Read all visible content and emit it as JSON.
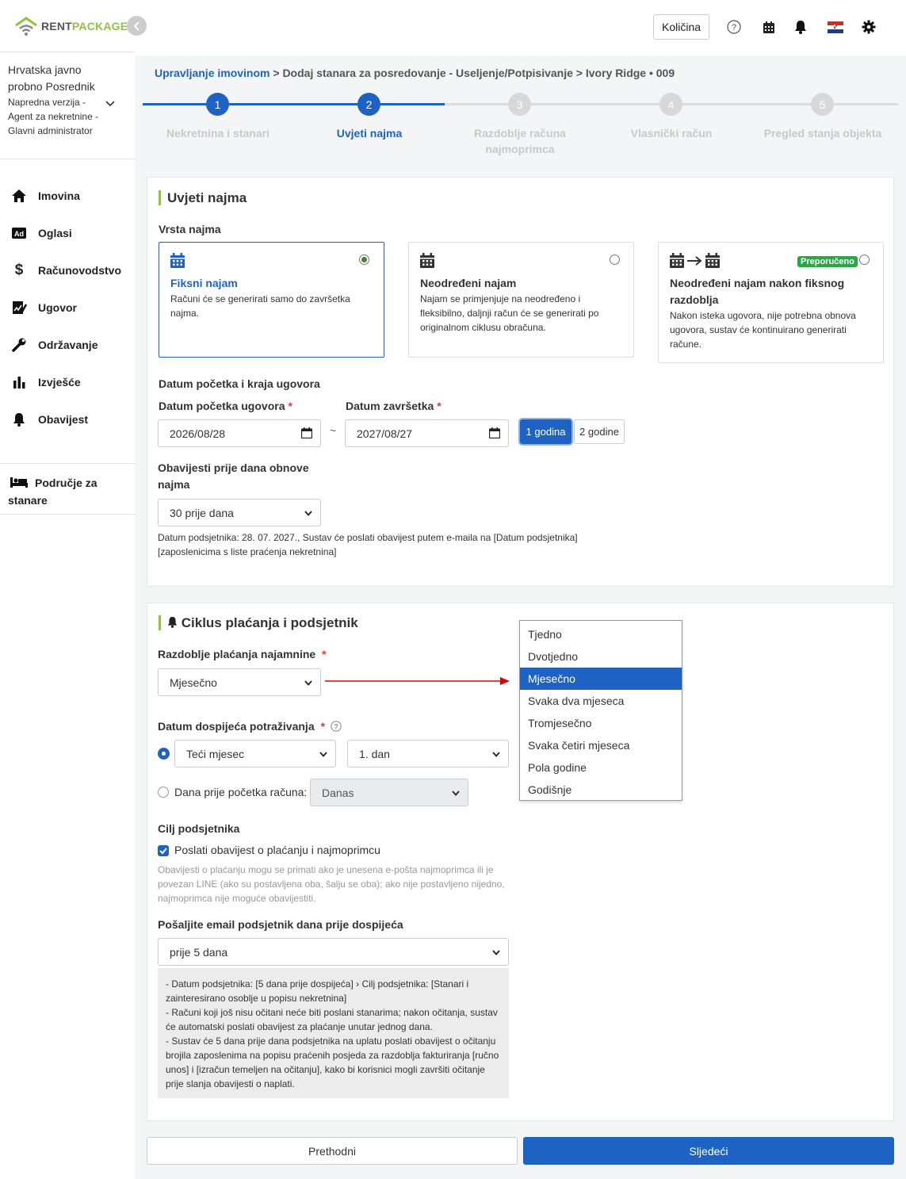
{
  "app": {
    "logo_text_1": "RENT",
    "logo_text_2": "PACKAGE"
  },
  "account": {
    "name": "Hrvatska javno probno Posrednik",
    "details": "Napredna verzija - Agent za nekretnine - Glavni administrator"
  },
  "sidebar": {
    "items": [
      {
        "label": "Imovina",
        "icon": "home-icon"
      },
      {
        "label": "Oglasi",
        "icon": "ad-icon"
      },
      {
        "label": "Računovodstvo",
        "icon": "dollar-icon"
      },
      {
        "label": "Ugovor",
        "icon": "contract-icon"
      },
      {
        "label": "Održavanje",
        "icon": "wrench-icon"
      },
      {
        "label": "Izvješće",
        "icon": "bar-chart-icon"
      },
      {
        "label": "Obavijest",
        "icon": "bell-icon"
      }
    ],
    "tenant_area": "Područje za stanare"
  },
  "topbar": {
    "quantity_button": "Količina"
  },
  "breadcrumb": {
    "root": "Upravljanje imovinom",
    "path": "> Dodaj stanara za posredovanje - Useljenje/Potpisivanje > Ivory Ridge • 009"
  },
  "stepper": {
    "active_step": 2,
    "steps": [
      {
        "num": "1",
        "label": "Nekretnina i stanari"
      },
      {
        "num": "2",
        "label": "Uvjeti najma"
      },
      {
        "num": "3",
        "label": "Razdoblje računa najmoprimca"
      },
      {
        "num": "4",
        "label": "Vlasnički račun"
      },
      {
        "num": "5",
        "label": "Pregled stanja objekta"
      }
    ]
  },
  "lease_terms": {
    "title": "Uvjeti najma",
    "lease_type_label": "Vrsta najma",
    "options": [
      {
        "title": "Fiksni najam",
        "desc": "Računi će se generirati samo do završetka najma.",
        "selected": true
      },
      {
        "title": "Neodređeni najam",
        "desc": "Najam se primjenjuje na neodređeno i fleksibilno, daljnji račun će se generirati po originalnom ciklusu obračuna.",
        "selected": false
      },
      {
        "title": "Neodređeni najam nakon fiksnog razdoblja",
        "desc": "Nakon isteka ugovora, nije potrebna obnova ugovora, sustav će kontinuirano generirati račune.",
        "selected": false,
        "badge": "Preporučeno"
      }
    ],
    "date_section_label": "Datum početka i kraja ugovora",
    "start_label": "Datum početka ugovora",
    "end_label": "Datum završetka",
    "required_mark": "*",
    "start_value": "2026/08/28",
    "end_value": "2027/08/27",
    "tilde": "~",
    "btn_1y": "1 godina",
    "btn_2y": "2 godine",
    "renewal_label": "Obavijesti prije dana obnove najma",
    "renewal_value": "30 prije dana",
    "renewal_note": "Datum podsjetnika: 28. 07. 2027., Sustav će poslati obavijest putem e-maila na [Datum podsjetnika] [zaposlenicima s liste praćenja nekretnina]"
  },
  "payment_cycle": {
    "title": "Ciklus plaćanja i podsjetnik",
    "period_label": "Razdoblje plaćanja najamnine",
    "period_value": "Mjesečno",
    "due_label": "Datum dospijeća potraživanja",
    "due_month": "Teći mjesec",
    "due_day": "1. dan",
    "days_before_label": "Dana prije početka računa:",
    "days_before_value": "Danas",
    "target_label": "Cilj podsjetnika",
    "checkbox_label": "Poslati obavijest o plaćanju i najmoprimcu",
    "checkbox_note": "Obavijesti o plaćanju mogu se primati ako je unesena e-pošta najmoprimca ili je povezan LINE (ako su postavljena oba, šalju se oba); ako nije postavljeno nijedno, najmoprimca nije moguće obavijestiti.",
    "email_label": "Pošaljite email podsjetnik dana prije dospijeća",
    "email_value": "prije 5 dana",
    "info_lines": [
      "- Datum podsjetnika: [5 dana prije dospijeća] › Cilj podsjetnika: [Stanari i zainteresirano osoblje u popisu nekretnina]",
      "- Računi koji još nisu očitani neće biti poslani stanarima; nakon očitanja, sustav će automatski poslati obavijest za plaćanje unutar jednog dana.",
      "- Sustav će 5 dana prije dana podsjetnika na uplatu poslati obavijest o očitanju brojila zaposlenima na popisu praćenih posjeda za razdoblja fakturiranja [ručno unos] i [izračun temeljen na očitanju], kako bi korisnici mogli završiti očitanje prije slanja obavijesti o naplati."
    ]
  },
  "dropdown": {
    "options": [
      "Tjedno",
      "Dvotjedno",
      "Mjesečno",
      "Svaka dva mjeseca",
      "Tromjesečno",
      "Svaka četiri mjeseca",
      "Pola godine",
      "Godišnje"
    ],
    "selected": "Mjesečno"
  },
  "footer": {
    "prev": "Prethodni",
    "next": "Sljedeći"
  },
  "colors": {
    "primary": "#1e63c4",
    "accent_green": "#8cc63f",
    "badge_green": "#28a745",
    "arrow_red": "#e00000"
  }
}
